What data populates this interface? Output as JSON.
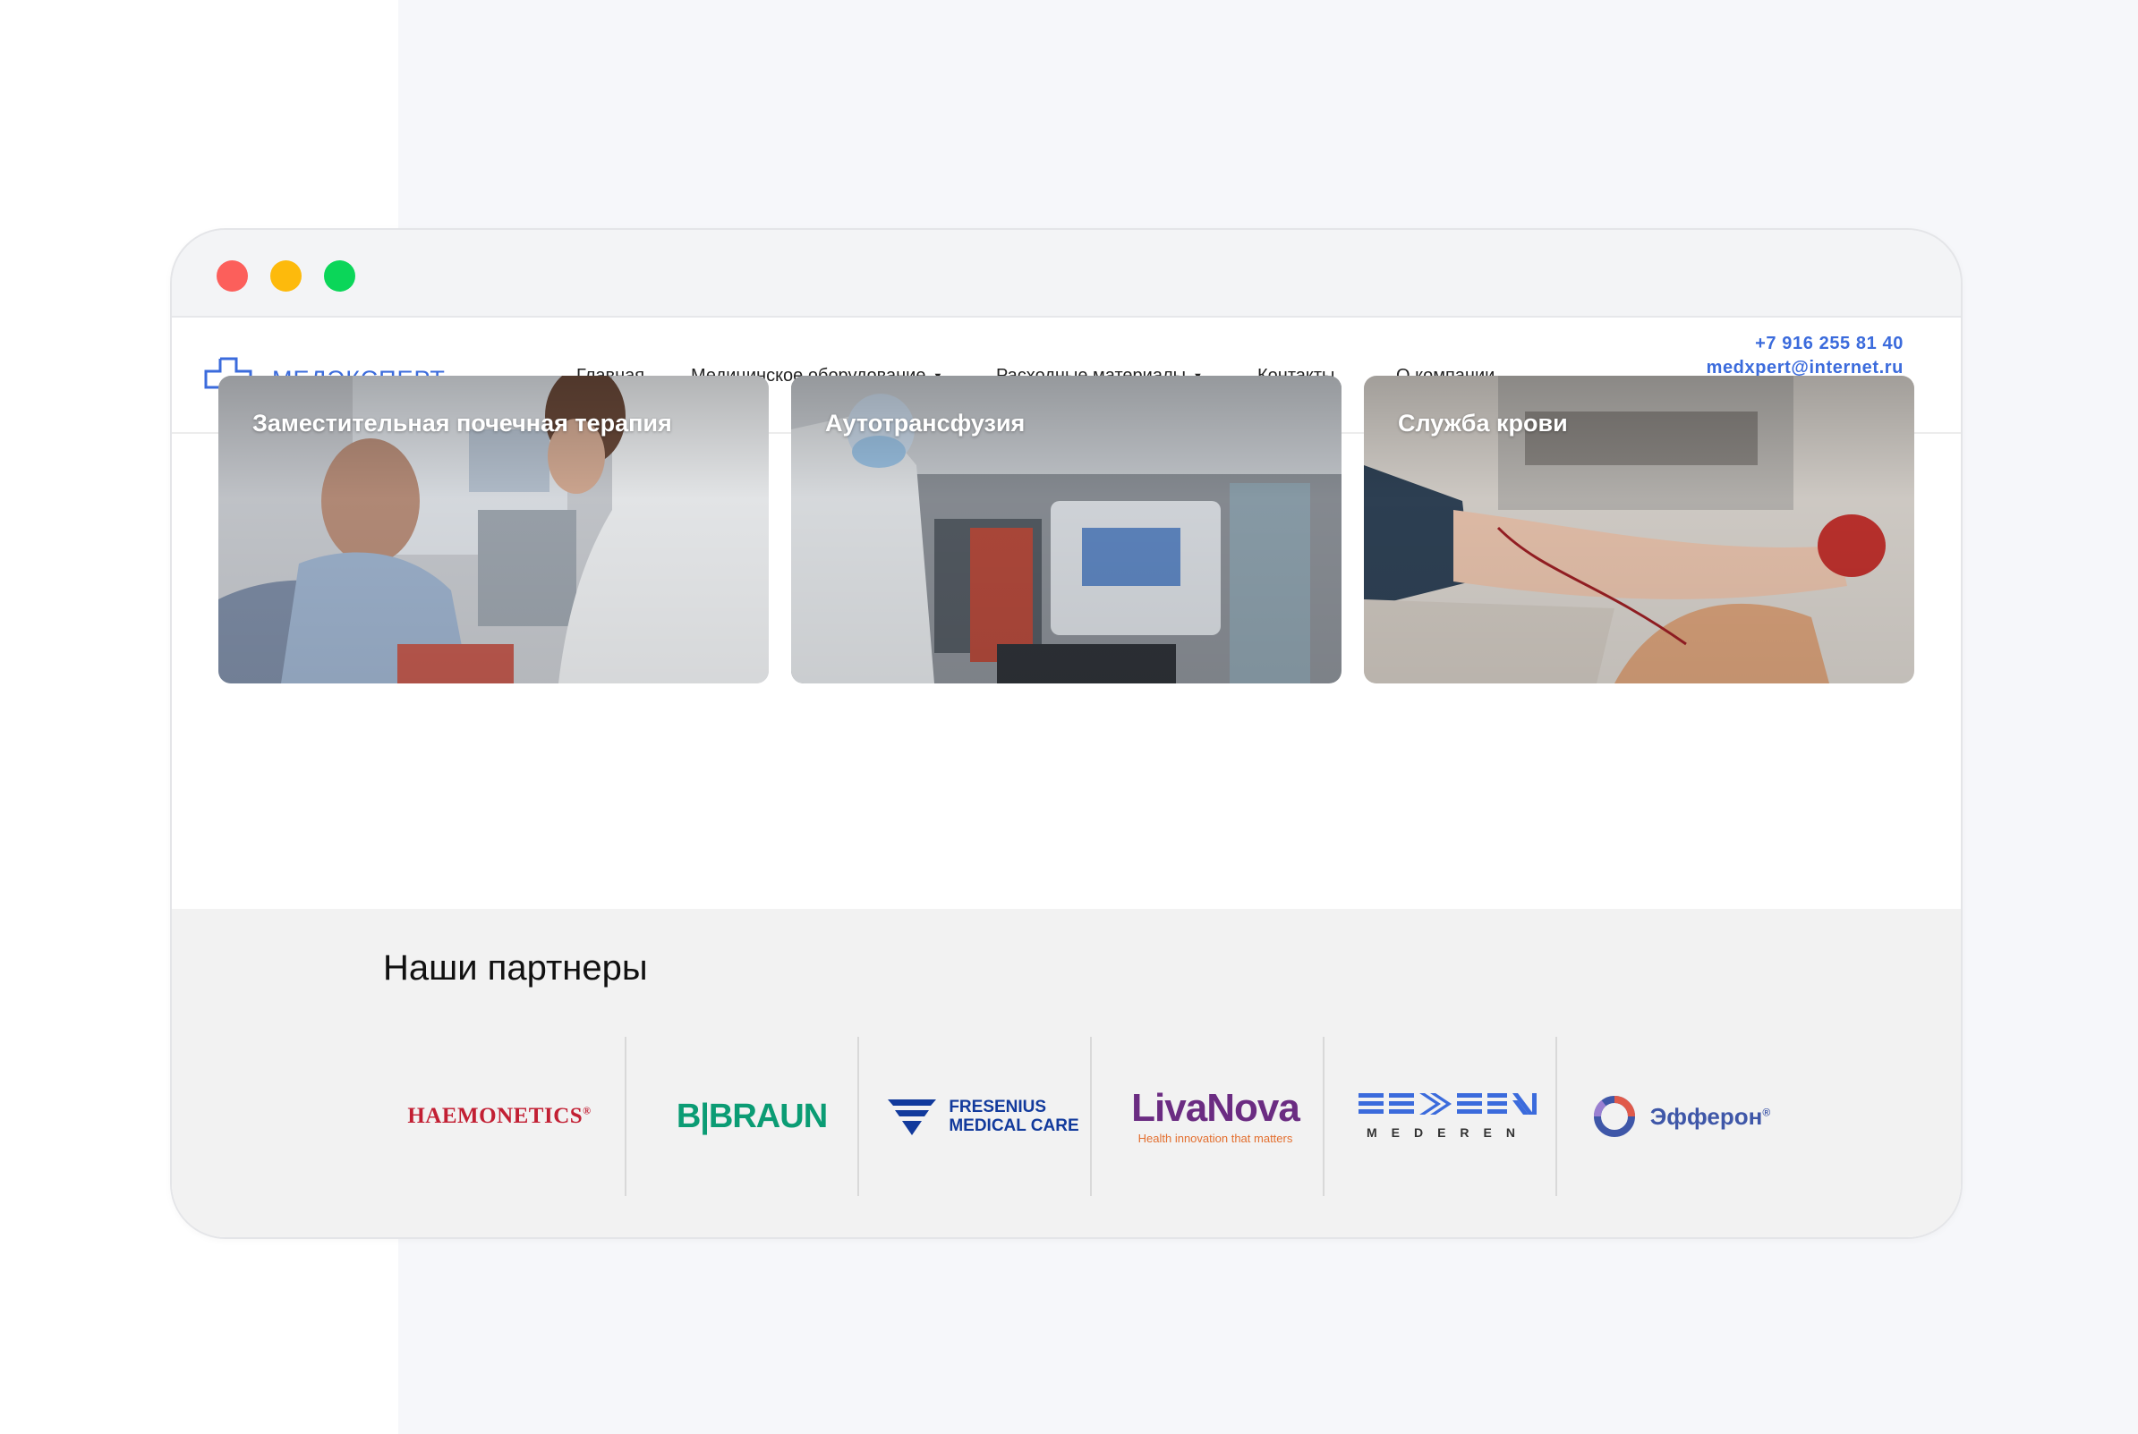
{
  "brand": {
    "name": "МЕДЭКСПЕРТ",
    "accent": "#3b6bdc"
  },
  "nav": [
    {
      "label": "Главная",
      "dropdown": false
    },
    {
      "label": "Медицинское оборудование",
      "dropdown": true
    },
    {
      "label": "Расходные материалы",
      "dropdown": true
    },
    {
      "label": "Контакты",
      "dropdown": false
    },
    {
      "label": "О компании",
      "dropdown": false
    }
  ],
  "contacts": {
    "phone": "+7 916 255 81 40",
    "email": "medxpert@internet.ru",
    "socials": [
      "email-icon",
      "whatsapp-icon",
      "telegram-icon"
    ]
  },
  "cards": [
    {
      "title": "Заместительная почечная терапия"
    },
    {
      "title": "Аутотрансфузия"
    },
    {
      "title": "Служба крови"
    }
  ],
  "partners": {
    "title": "Наши партнеры",
    "logos": [
      {
        "name": "HAEMONETICS",
        "mark": "®"
      },
      {
        "name": "B|BRAUN"
      },
      {
        "name": "FRESENIUS",
        "line2": "MEDICAL CARE"
      },
      {
        "name": "LivaNova",
        "tagline": "Health innovation that matters"
      },
      {
        "name": "MEDEREN"
      },
      {
        "name": "Эфферон",
        "mark": "®"
      }
    ]
  }
}
